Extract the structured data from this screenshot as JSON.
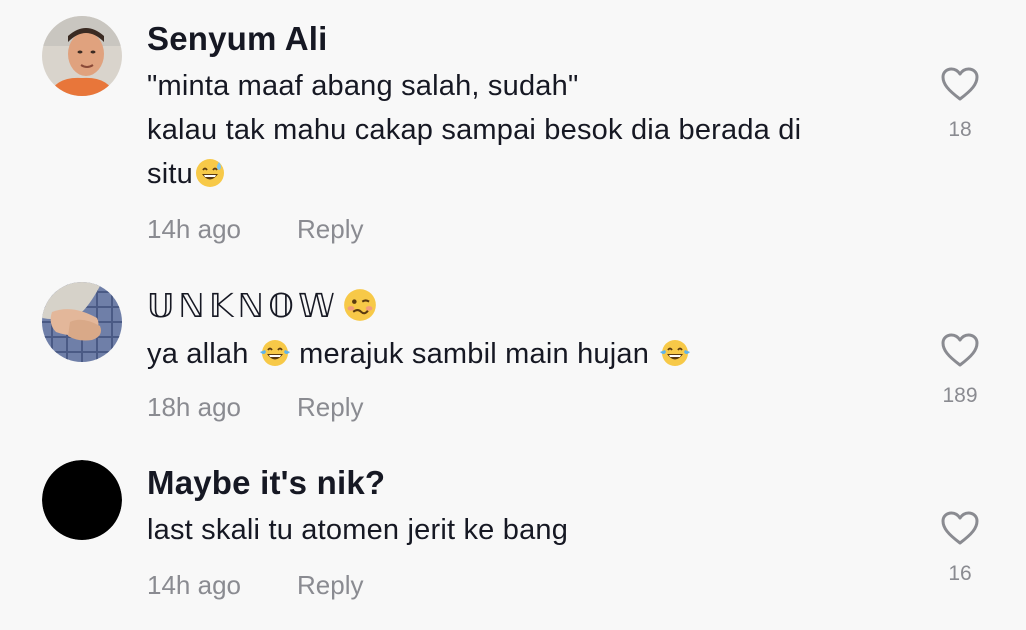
{
  "comments": [
    {
      "username": "Senyum Ali",
      "lines": [
        "\"minta maaf abang salah, sudah\"",
        "kalau tak mahu cakap sampai besok dia berada di",
        "situ"
      ],
      "time": "14h ago",
      "reply_label": "Reply",
      "likes": "18",
      "avatar_icon": "photo-avatar-man",
      "emoji_icon": "grinning-sweat-emoji"
    },
    {
      "username": "𝕌ℕ𝕂ℕ𝕆𝕎",
      "lines": [
        "ya allah",
        "merajuk sambil main hujan"
      ],
      "time": "18h ago",
      "reply_label": "Reply",
      "likes": "189",
      "avatar_icon": "photo-avatar-hands",
      "name_emoji_icon": "woozy-face-emoji",
      "text_emoji_icon": "tears-of-joy-emoji"
    },
    {
      "username": "Maybe it's nik?",
      "lines": [
        "last skali tu atomen jerit ke bang"
      ],
      "time": "14h ago",
      "reply_label": "Reply",
      "likes": "16",
      "avatar_icon": "black-avatar"
    }
  ],
  "colors": {
    "background": "#f8f8f8",
    "text": "#161823",
    "muted": "#8a8b91",
    "heart": "#8a8b91"
  }
}
